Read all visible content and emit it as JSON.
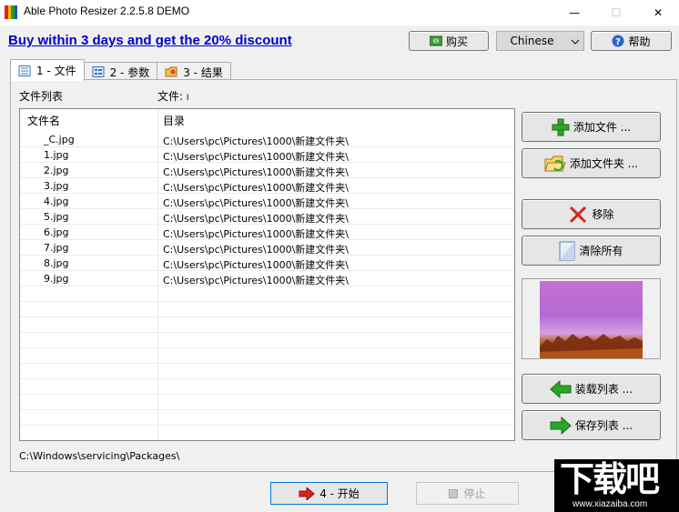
{
  "window": {
    "title": "Able Photo Resizer 2.2.5.8 DEMO",
    "minimize_glyph": "—",
    "maximize_glyph": "☐",
    "close_glyph": "✕"
  },
  "header": {
    "promo_link": "Buy within 3 days and get the 20% discount",
    "buy_label": "购买",
    "language_selected": "Chinese",
    "help_label": "帮助"
  },
  "tabs": [
    {
      "label": "1 - 文件",
      "icon": "file-list-icon",
      "active": true
    },
    {
      "label": "2 - 参数",
      "icon": "settings-sheet-icon",
      "active": false
    },
    {
      "label": "3 - 结果",
      "icon": "result-folder-icon",
      "active": false
    }
  ],
  "file_panel": {
    "list_label": "文件列表",
    "count_label": "文件:",
    "count_value": "I",
    "columns": [
      "文件名",
      "目录"
    ],
    "rows": [
      {
        "name": "_C.jpg",
        "dir": "C:\\Users\\pc\\Pictures\\1000\\新建文件夹\\"
      },
      {
        "name": "1.jpg",
        "dir": "C:\\Users\\pc\\Pictures\\1000\\新建文件夹\\"
      },
      {
        "name": "2.jpg",
        "dir": "C:\\Users\\pc\\Pictures\\1000\\新建文件夹\\"
      },
      {
        "name": "3.jpg",
        "dir": "C:\\Users\\pc\\Pictures\\1000\\新建文件夹\\"
      },
      {
        "name": "4.jpg",
        "dir": "C:\\Users\\pc\\Pictures\\1000\\新建文件夹\\"
      },
      {
        "name": "5.jpg",
        "dir": "C:\\Users\\pc\\Pictures\\1000\\新建文件夹\\"
      },
      {
        "name": "6.jpg",
        "dir": "C:\\Users\\pc\\Pictures\\1000\\新建文件夹\\"
      },
      {
        "name": "7.jpg",
        "dir": "C:\\Users\\pc\\Pictures\\1000\\新建文件夹\\"
      },
      {
        "name": "8.jpg",
        "dir": "C:\\Users\\pc\\Pictures\\1000\\新建文件夹\\"
      },
      {
        "name": "9.jpg",
        "dir": "C:\\Users\\pc\\Pictures\\1000\\新建文件夹\\"
      }
    ],
    "status_path": "C:\\Windows\\servicing\\Packages\\"
  },
  "side_buttons": {
    "add_files": "添加文件 ...",
    "add_folder": "添加文件夹 ...",
    "remove": "移除",
    "clear_all": "清除所有",
    "load_list": "装载列表 ...",
    "save_list": "保存列表 ..."
  },
  "actions": {
    "start_label": "4 - 开始",
    "stop_label": "停止"
  },
  "watermark": {
    "big": "下载吧",
    "small": "www.xiazaiba.com"
  },
  "colors": {
    "accent_link": "#0000cc",
    "start_border": "#0078d7",
    "add_green": "#2fa52f",
    "remove_red": "#d8261c",
    "arrow_green": "#27a827"
  }
}
